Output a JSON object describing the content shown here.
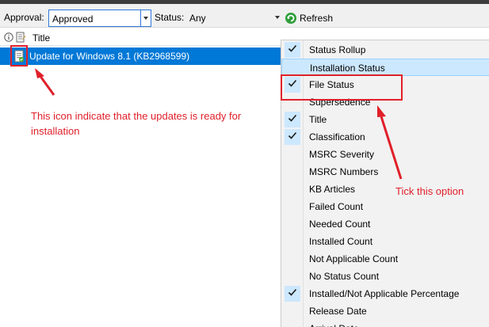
{
  "toolbar": {
    "approval_label": "Approval:",
    "approval_value": "Approved",
    "status_label": "Status:",
    "status_value": "Any",
    "refresh_label": "Refresh"
  },
  "list": {
    "column_title": "Title",
    "selected_row_title": "Update for Windows 8.1 (KB2968599)"
  },
  "annotations": {
    "icon_note": "This icon indicate that the updates is ready for installation",
    "tick_note": "Tick this option"
  },
  "columns_menu": {
    "items": [
      {
        "label": "Status Rollup",
        "checked": true
      },
      {
        "label": "Installation Status",
        "checked": false,
        "highlighted": true
      },
      {
        "label": "File Status",
        "checked": true
      },
      {
        "label": "Supersedence",
        "checked": false
      },
      {
        "label": "Title",
        "checked": true
      },
      {
        "label": "Classification",
        "checked": true
      },
      {
        "label": "MSRC Severity",
        "checked": false
      },
      {
        "label": "MSRC Numbers",
        "checked": false
      },
      {
        "label": "KB Articles",
        "checked": false
      },
      {
        "label": "Failed Count",
        "checked": false
      },
      {
        "label": "Needed Count",
        "checked": false
      },
      {
        "label": "Installed Count",
        "checked": false
      },
      {
        "label": "Not Applicable Count",
        "checked": false
      },
      {
        "label": "No Status Count",
        "checked": false
      },
      {
        "label": "Installed/Not Applicable Percentage",
        "checked": true
      },
      {
        "label": "Release Date",
        "checked": false
      },
      {
        "label": "Arrival Date",
        "checked": false
      }
    ]
  },
  "colors": {
    "selection": "#0078d7",
    "annotation": "#e0202a",
    "menu_bg": "#f2f2f2",
    "menu_check_bg": "#cce8ff"
  }
}
